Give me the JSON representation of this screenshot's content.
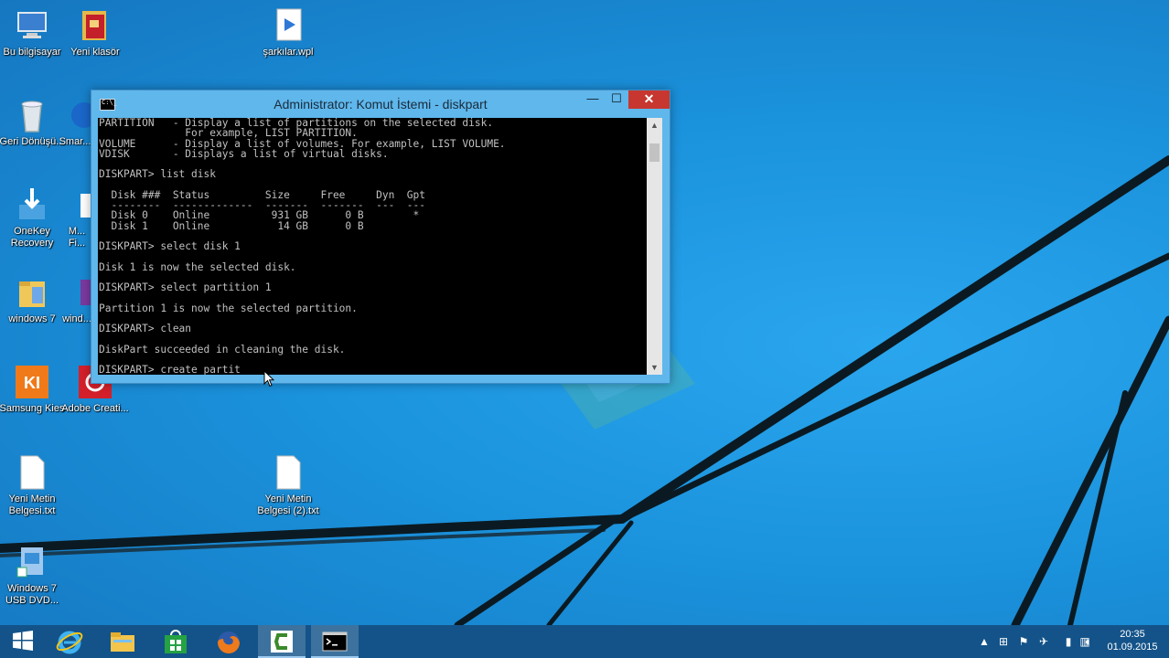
{
  "desktop": {
    "icons": [
      {
        "label": "Bu bilgisayar"
      },
      {
        "label": "Yeni klasör"
      },
      {
        "label": "şarkılar.wpl"
      },
      {
        "label": "Geri Dönüşü..."
      },
      {
        "label": "Smar..."
      },
      {
        "label": "OneKey Recovery"
      },
      {
        "label": "M... Fi..."
      },
      {
        "label": "windows 7"
      },
      {
        "label": "wind..."
      },
      {
        "label": "Samsung Kies"
      },
      {
        "label": "Adobe Creati..."
      },
      {
        "label": "Yeni Metin Belgesi.txt"
      },
      {
        "label": "Yeni Metin Belgesi (2).txt"
      },
      {
        "label": "Windows 7 USB DVD..."
      }
    ]
  },
  "cmd": {
    "title": "Administrator: Komut İstemi - diskpart",
    "min_label": "—",
    "max_label": "☐",
    "close_label": "✕",
    "app_icon_text": "C:\\_",
    "lines": [
      "PARTITION   - Display a list of partitions on the selected disk.",
      "              For example, LIST PARTITION.",
      "VOLUME      - Display a list of volumes. For example, LIST VOLUME.",
      "VDISK       - Displays a list of virtual disks.",
      "",
      "DISKPART> list disk",
      "",
      "  Disk ###  Status         Size     Free     Dyn  Gpt",
      "  --------  -------------  -------  -------  ---  ---",
      "  Disk 0    Online          931 GB      0 B        *",
      "  Disk 1    Online           14 GB      0 B",
      "",
      "DISKPART> select disk 1",
      "",
      "Disk 1 is now the selected disk.",
      "",
      "DISKPART> select partition 1",
      "",
      "Partition 1 is now the selected partition.",
      "",
      "DISKPART> clean",
      "",
      "DiskPart succeeded in cleaning the disk.",
      "",
      "DISKPART> create partit"
    ]
  },
  "taskbar": {
    "items": [
      {
        "name": "start"
      },
      {
        "name": "internet-explorer"
      },
      {
        "name": "file-explorer"
      },
      {
        "name": "store"
      },
      {
        "name": "firefox"
      },
      {
        "name": "camtasia"
      },
      {
        "name": "command-prompt"
      }
    ],
    "clock_time": "20:35",
    "clock_date": "01.09.2015"
  },
  "colors": {
    "desktop_blue": "#1b93dd",
    "close_red": "#c7372f",
    "console_bg": "#000000",
    "console_text": "#c0c0c0"
  }
}
